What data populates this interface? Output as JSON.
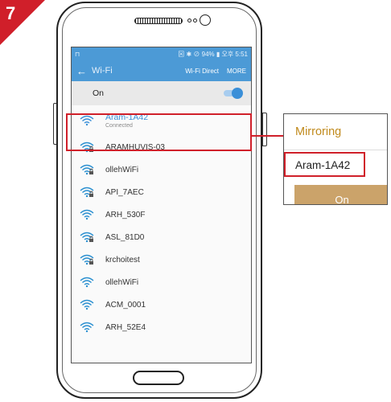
{
  "step": {
    "number": "7"
  },
  "status_bar": {
    "left": "⊓",
    "right": "⊠ ✱ ⊘ 94% ▮ 오후 5:51"
  },
  "app_bar": {
    "back": "←",
    "title": "Wi-Fi",
    "wifi_direct": "Wi-Fi Direct",
    "more": "MORE"
  },
  "wifi_switch": {
    "label": "On",
    "state": "on"
  },
  "networks": [
    {
      "name": "Aram-1A42",
      "status": "Connected",
      "secured": false
    },
    {
      "name": "ARAMHUVIS-03",
      "secured": true
    },
    {
      "name": "ollehWiFi",
      "secured": true
    },
    {
      "name": "API_7AEC",
      "secured": true
    },
    {
      "name": "ARH_530F",
      "secured": false
    },
    {
      "name": "ASL_81D0",
      "secured": true
    },
    {
      "name": "krchoitest",
      "secured": true
    },
    {
      "name": "ollehWiFi",
      "secured": false
    },
    {
      "name": "ACM_0001",
      "secured": false
    },
    {
      "name": "ARH_52E4",
      "secured": false
    }
  ],
  "mirroring_popup": {
    "title": "Mirroring",
    "device_name": "Aram-1A42",
    "button": "On"
  },
  "colors": {
    "accent": "#4c9ad6",
    "highlight": "#d0202a",
    "gold": "#cba36a",
    "step": "#d01f2a"
  }
}
